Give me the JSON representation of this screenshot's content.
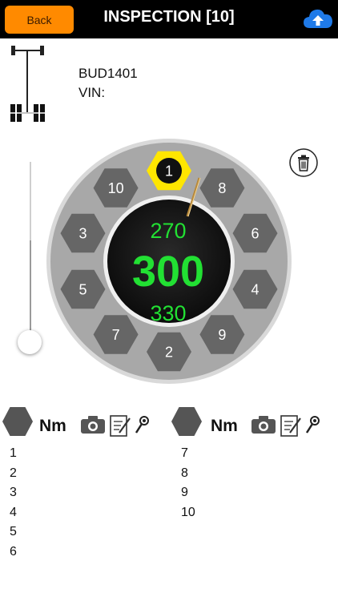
{
  "header": {
    "back_label": "Back",
    "title": "INSPECTION [10]",
    "upload_icon": "cloud-upload-icon"
  },
  "vehicle": {
    "plate": "BUD1401",
    "vin": "VIN:",
    "diagram_icon": "axle-diagram-icon"
  },
  "dial": {
    "upper_value": "270",
    "main_value": "300",
    "lower_value": "330",
    "bolts": [
      "1",
      "8",
      "6",
      "4",
      "9",
      "2",
      "7",
      "5",
      "3",
      "10"
    ],
    "active_bolt": "1",
    "colors": {
      "value_green": "#22e033",
      "active_hex": "#ffe600",
      "hex_gray": "#666666"
    }
  },
  "slider": {
    "level_percent": 100
  },
  "table": {
    "left_header": {
      "unit": "Nm"
    },
    "right_header": {
      "unit": "Nm"
    },
    "left_rows": [
      "1",
      "2",
      "3",
      "4",
      "5",
      "6"
    ],
    "right_rows": [
      "7",
      "8",
      "9",
      "10"
    ],
    "icons": [
      "hexagon-icon",
      "camera-icon",
      "notes-icon",
      "torque-wrench-icon"
    ]
  },
  "trash_icon": "trash-icon"
}
